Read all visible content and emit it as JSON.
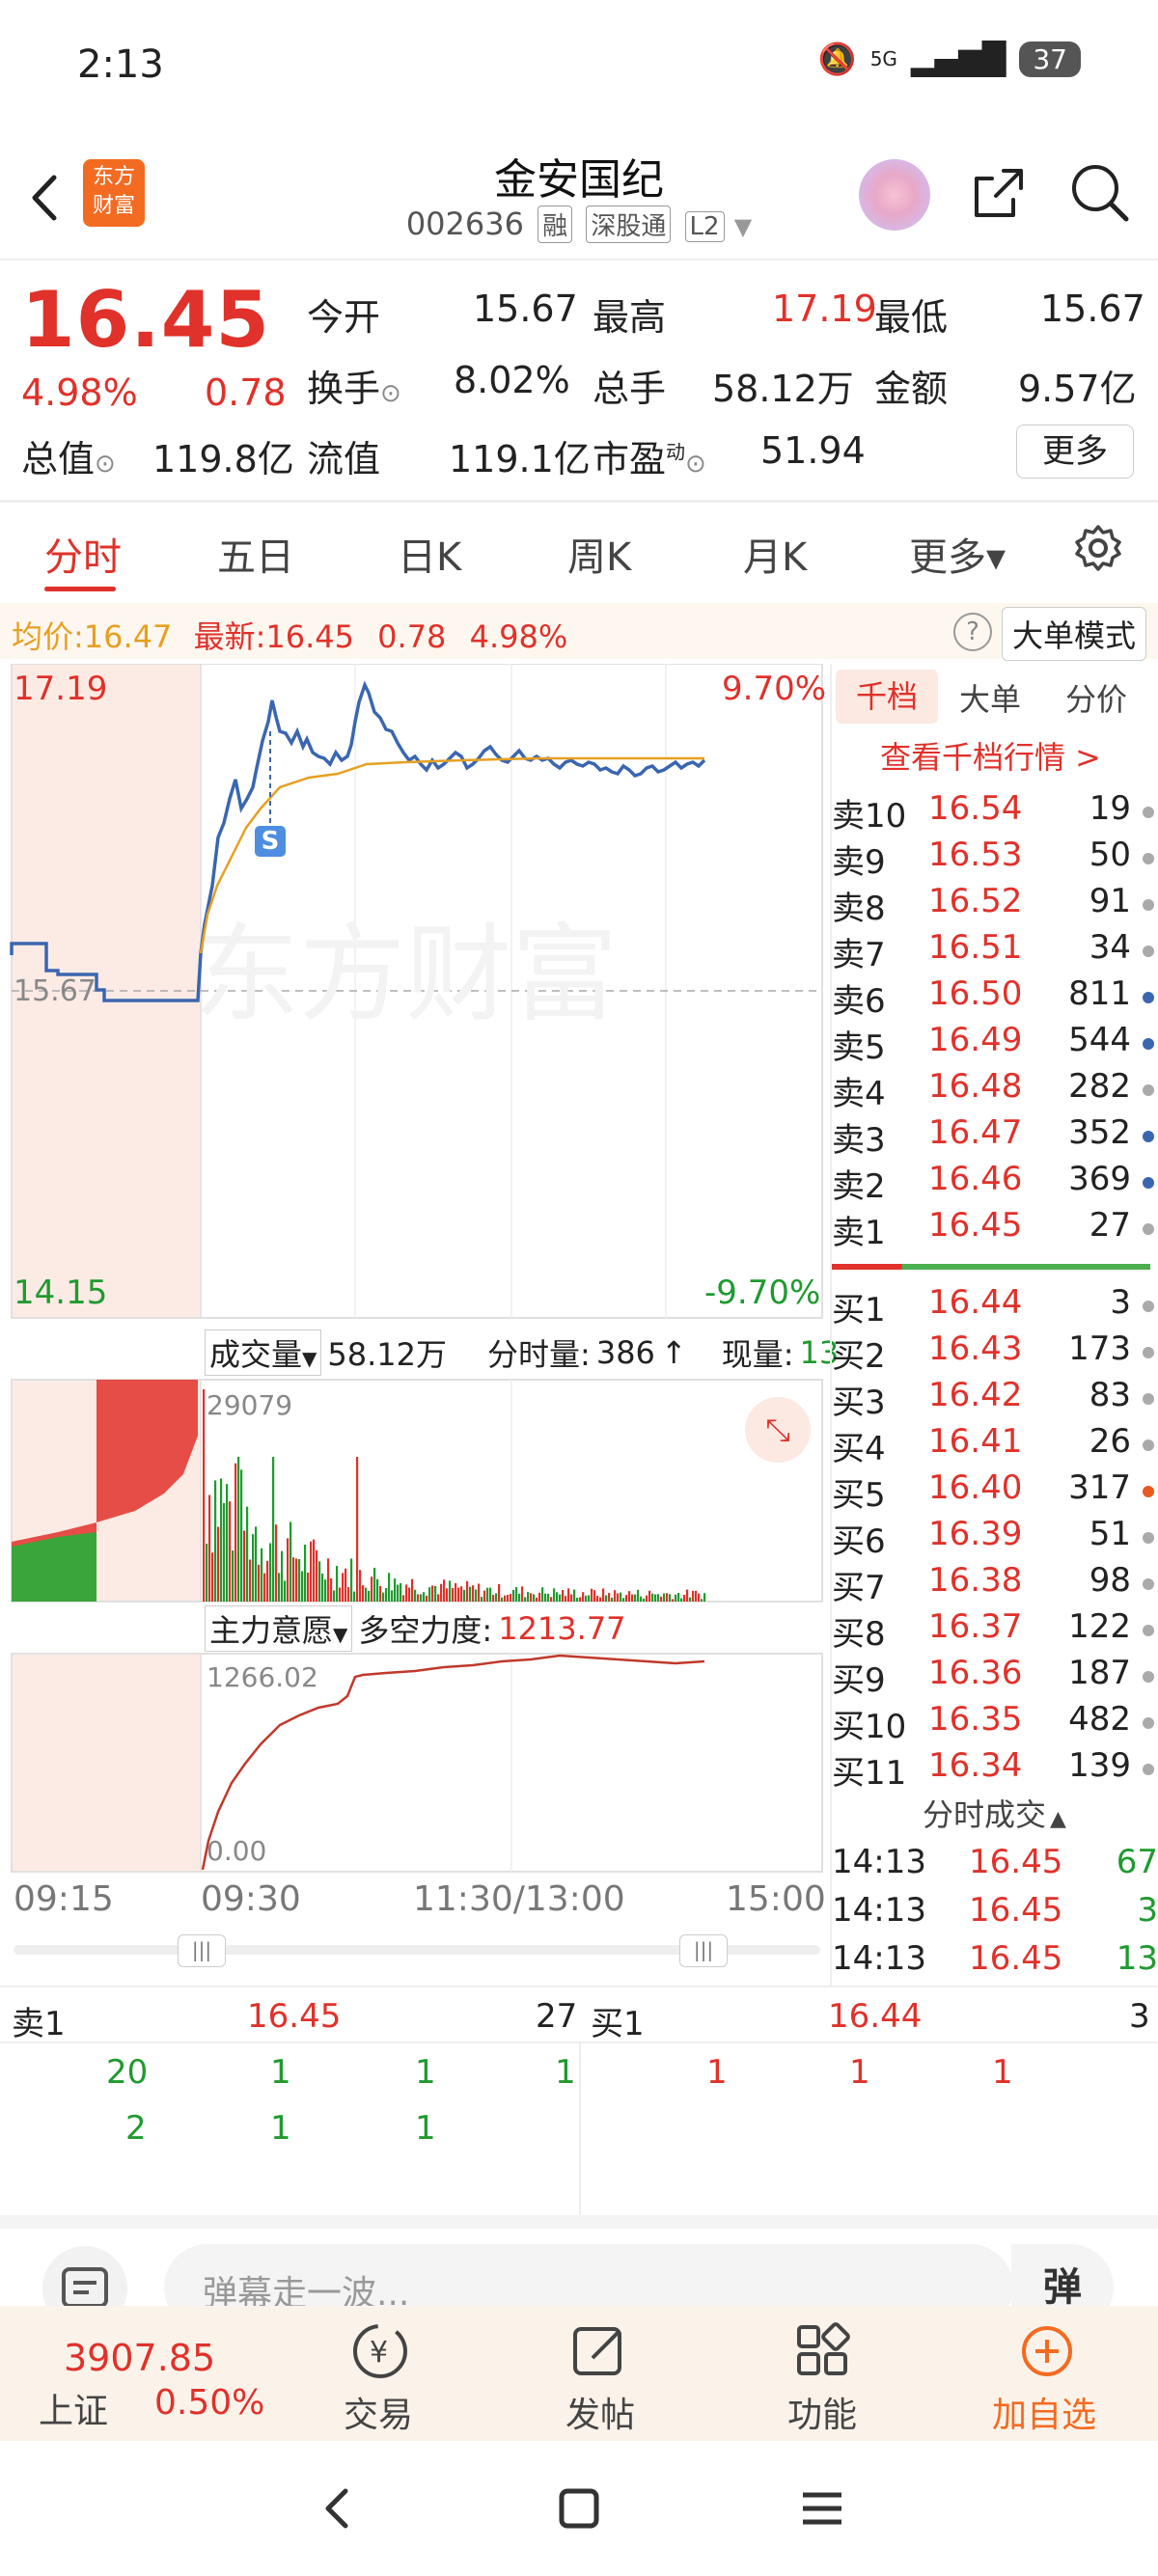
{
  "status_bar": {
    "time": "2:13",
    "signal": "5G",
    "battery": "37"
  },
  "header": {
    "logo_text_line1": "东方",
    "logo_text_line2": "财富",
    "stock_name": "金安国纪",
    "stock_code": "002636",
    "tags": [
      "融",
      "深股通",
      "L2"
    ]
  },
  "quote": {
    "price": "16.45",
    "change_pct": "4.98%",
    "change": "0.78",
    "rows": [
      [
        {
          "label": "今开",
          "value": "15.67",
          "color": "#222"
        },
        {
          "label": "最高",
          "value": "17.19",
          "color": "#e0312a"
        },
        {
          "label": "最低",
          "value": "15.67",
          "color": "#222"
        }
      ],
      [
        {
          "label": "换手",
          "value": "8.02%",
          "color": "#222"
        },
        {
          "label": "总手",
          "value": "58.12万",
          "color": "#222"
        },
        {
          "label": "金额",
          "value": "9.57亿",
          "color": "#222"
        }
      ]
    ],
    "row3": {
      "total_cap_label": "总值",
      "total_cap": "119.8亿",
      "float_cap_label": "流值",
      "float_cap": "119.1亿",
      "pe_label": "市盈",
      "pe_sup": "动",
      "pe": "51.94"
    },
    "more_button": "更多"
  },
  "tabs": [
    {
      "label": "分时",
      "active": true
    },
    {
      "label": "五日",
      "active": false
    },
    {
      "label": "日K",
      "active": false
    },
    {
      "label": "周K",
      "active": false
    },
    {
      "label": "月K",
      "active": false
    },
    {
      "label": "更多▾",
      "active": false
    }
  ],
  "info_bar": {
    "avg_label": "均价:",
    "avg_value": "16.47",
    "latest_label": "最新:",
    "latest_value": "16.45",
    "latest_change": "0.78",
    "latest_pct": "4.98%",
    "help": "?",
    "big_order_mode": "大单模式"
  },
  "price_chart": {
    "y_top": "17.19",
    "y_bottom": "14.15",
    "pct_top": "9.70%",
    "pct_bottom": "-9.70%",
    "prev_close": "15.67",
    "watermark": "东方财富",
    "marker": "S"
  },
  "volume_panel": {
    "selector": "成交量",
    "total": "58.12万",
    "minute_label": "分时量:",
    "minute_value": "386",
    "minute_arrow": "↑",
    "current_label": "现量:",
    "current_value": "13",
    "max_value": "29079"
  },
  "force_panel": {
    "selector": "主力意愿",
    "label": "多空力度:",
    "value": "1213.77",
    "max": "1266.02",
    "min": "0.00"
  },
  "time_axis": [
    "09:15",
    "09:30",
    "11:30/13:00",
    "15:00"
  ],
  "order_book": {
    "tabs": [
      "千档",
      "大单",
      "分价"
    ],
    "link": "查看千档行情 >",
    "asks": [
      {
        "label": "卖10",
        "price": "16.54",
        "vol": "19",
        "dot": "#aaa"
      },
      {
        "label": "卖9",
        "price": "16.53",
        "vol": "50",
        "dot": "#aaa"
      },
      {
        "label": "卖8",
        "price": "16.52",
        "vol": "91",
        "dot": "#aaa"
      },
      {
        "label": "卖7",
        "price": "16.51",
        "vol": "34",
        "dot": "#aaa"
      },
      {
        "label": "卖6",
        "price": "16.50",
        "vol": "811",
        "dot": "#3a66b0"
      },
      {
        "label": "卖5",
        "price": "16.49",
        "vol": "544",
        "dot": "#3a66b0"
      },
      {
        "label": "卖4",
        "price": "16.48",
        "vol": "282",
        "dot": "#aaa"
      },
      {
        "label": "卖3",
        "price": "16.47",
        "vol": "352",
        "dot": "#3a66b0"
      },
      {
        "label": "卖2",
        "price": "16.46",
        "vol": "369",
        "dot": "#3a66b0"
      },
      {
        "label": "卖1",
        "price": "16.45",
        "vol": "27",
        "dot": "#aaa"
      }
    ],
    "bids": [
      {
        "label": "买1",
        "price": "16.44",
        "vol": "3",
        "dot": "#aaa"
      },
      {
        "label": "买2",
        "price": "16.43",
        "vol": "173",
        "dot": "#aaa"
      },
      {
        "label": "买3",
        "price": "16.42",
        "vol": "83",
        "dot": "#aaa"
      },
      {
        "label": "买4",
        "price": "16.41",
        "vol": "26",
        "dot": "#aaa"
      },
      {
        "label": "买5",
        "price": "16.40",
        "vol": "317",
        "dot": "#e85a1e"
      },
      {
        "label": "买6",
        "price": "16.39",
        "vol": "51",
        "dot": "#aaa"
      },
      {
        "label": "买7",
        "price": "16.38",
        "vol": "98",
        "dot": "#aaa"
      },
      {
        "label": "买8",
        "price": "16.37",
        "vol": "122",
        "dot": "#aaa"
      },
      {
        "label": "买9",
        "price": "16.36",
        "vol": "187",
        "dot": "#aaa"
      },
      {
        "label": "买10",
        "price": "16.35",
        "vol": "482",
        "dot": "#aaa"
      },
      {
        "label": "买11",
        "price": "16.34",
        "vol": "139",
        "dot": "#aaa"
      }
    ]
  },
  "ticks": {
    "title": "分时成交",
    "arrow": "▲",
    "rows": [
      {
        "time": "14:13",
        "price": "16.45",
        "vol": "67"
      },
      {
        "time": "14:13",
        "price": "16.45",
        "vol": "3"
      },
      {
        "time": "14:13",
        "price": "16.45",
        "vol": "13"
      }
    ]
  },
  "queue": {
    "ask_label": "卖1",
    "ask_price": "16.45",
    "ask_vol": "27",
    "bid_label": "买1",
    "bid_price": "16.44",
    "bid_vol": "3",
    "ask_orders_row1": [
      "20",
      "1",
      "1",
      "1"
    ],
    "ask_orders_row2": [
      "2",
      "1",
      "1"
    ],
    "bid_orders_row1": [
      "1",
      "1",
      "1"
    ]
  },
  "danmaku": {
    "placeholder": "弹幕走一波...",
    "button": "弹"
  },
  "bottom_bar": {
    "index_value": "3907.85",
    "index_name": "上证",
    "index_pct": "0.50%",
    "trade": "交易",
    "post": "发帖",
    "function": "功能",
    "add_watch": "加自选"
  },
  "colors": {
    "up": "#e0312a",
    "down": "#1f9a2f",
    "price_line": "#3a66b0",
    "avg_line": "#e6a021",
    "accent": "#f36b21"
  }
}
